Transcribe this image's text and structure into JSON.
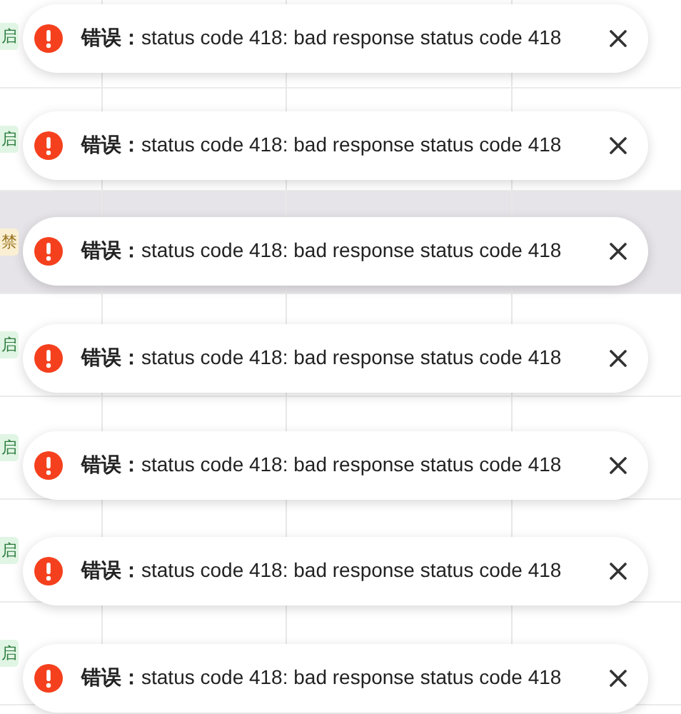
{
  "table": {
    "rows": [
      {
        "status": {
          "label": "启",
          "kind": "enabled"
        },
        "highlighted": false
      },
      {
        "status": {
          "label": "启",
          "kind": "enabled"
        },
        "highlighted": false
      },
      {
        "status": {
          "label": "禁",
          "kind": "disabled"
        },
        "highlighted": true
      },
      {
        "status": {
          "label": "启",
          "kind": "enabled"
        },
        "highlighted": false
      },
      {
        "status": {
          "label": "启",
          "kind": "enabled"
        },
        "highlighted": false
      },
      {
        "status": {
          "label": "启",
          "kind": "enabled"
        },
        "highlighted": false
      },
      {
        "status": {
          "label": "启",
          "kind": "enabled"
        },
        "highlighted": false
      }
    ]
  },
  "toasts": [
    {
      "kind": "error",
      "message": "**错误：**status code 418: bad response status code 418"
    },
    {
      "kind": "error",
      "message": "**错误：**status code 418: bad response status code 418"
    },
    {
      "kind": "error",
      "message": "**错误：**status code 418: bad response status code 418"
    },
    {
      "kind": "error",
      "message": "**错误：**status code 418: bad response status code 418"
    },
    {
      "kind": "error",
      "message": "**错误：**status code 418: bad response status code 418"
    },
    {
      "kind": "error",
      "message": "**错误：**status code 418: bad response status code 418"
    },
    {
      "kind": "error",
      "message": "**错误：**status code 418: bad response status code 418"
    }
  ]
}
